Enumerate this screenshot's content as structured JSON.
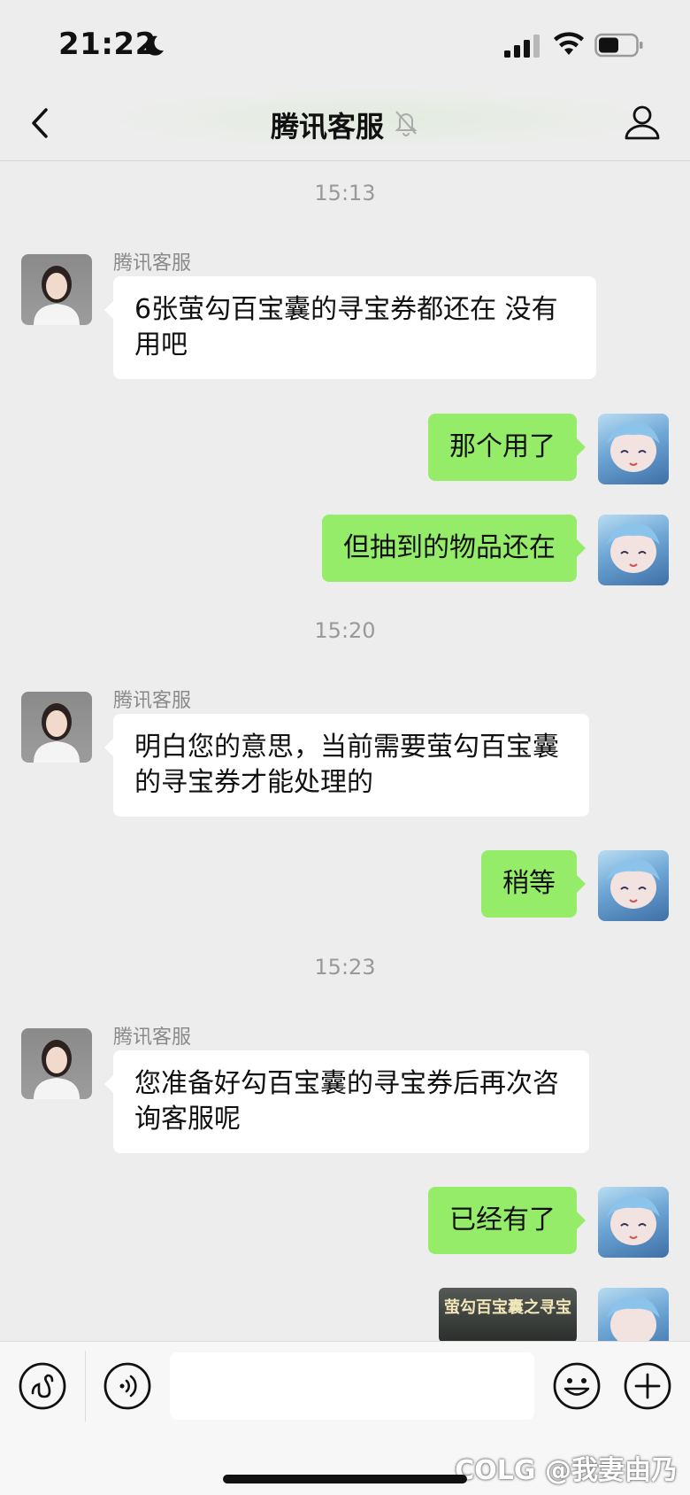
{
  "status_bar": {
    "time": "21:22"
  },
  "nav": {
    "title": "腾讯客服"
  },
  "chat": {
    "timestamps": [
      "15:13",
      "15:20",
      "15:23"
    ],
    "sender_name": "腾讯客服",
    "messages": [
      {
        "side": "in",
        "text": "6张萤勾百宝囊的寻宝券都还在  没有用吧"
      },
      {
        "side": "out",
        "text": "那个用了"
      },
      {
        "side": "out",
        "text": "但抽到的物品还在"
      },
      {
        "side": "in",
        "text": "明白您的意思，当前需要萤勾百宝囊的寻宝券才能处理的"
      },
      {
        "side": "out",
        "text": "稍等"
      },
      {
        "side": "in",
        "text": "您准备好勾百宝囊的寻宝券后再次咨询客服呢"
      },
      {
        "side": "out",
        "text": "已经有了"
      }
    ],
    "image_message_label": "萤勾百宝囊之寻宝"
  },
  "input_bar": {
    "placeholder": ""
  },
  "watermark": "COLG @我妻由乃"
}
